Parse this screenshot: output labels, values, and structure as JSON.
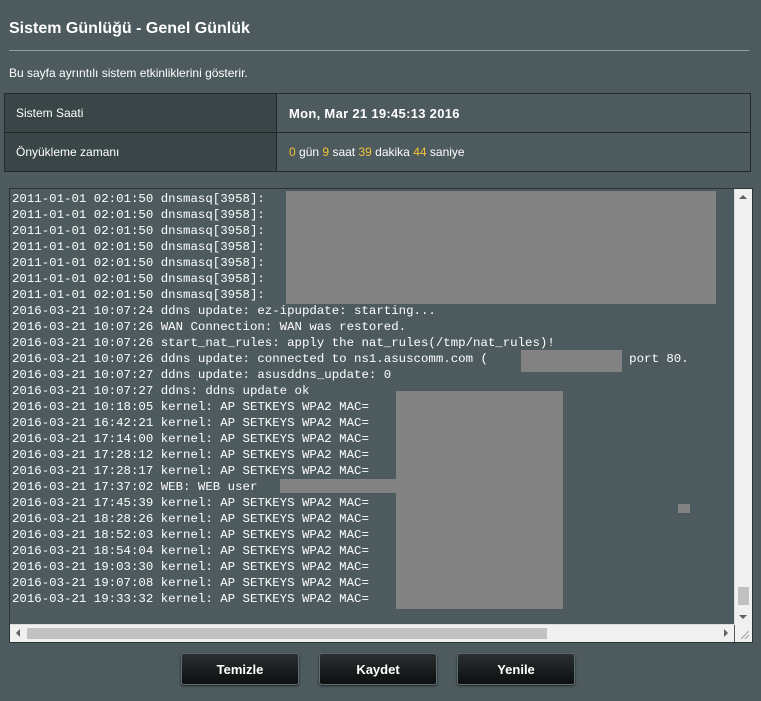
{
  "page": {
    "title": "Sistem Günlüğü - Genel Günlük",
    "description": "Bu sayfa ayrıntılı sistem etkinliklerini gösterir."
  },
  "info": {
    "system_time_label": "Sistem Saati",
    "system_time_value": "Mon, Mar 21 19:45:13 2016",
    "uptime_label": "Önyükleme zamanı",
    "uptime": {
      "days": "0",
      "days_unit": "gün",
      "hours": "9",
      "hours_unit": "saat",
      "minutes": "39",
      "minutes_unit": "dakika",
      "seconds": "44",
      "seconds_unit": "saniye"
    }
  },
  "log": {
    "lines": [
      "2011-01-01 02:01:50 dnsmasq[3958]:",
      "2011-01-01 02:01:50 dnsmasq[3958]:",
      "2011-01-01 02:01:50 dnsmasq[3958]:",
      "2011-01-01 02:01:50 dnsmasq[3958]:",
      "2011-01-01 02:01:50 dnsmasq[3958]:",
      "2011-01-01 02:01:50 dnsmasq[3958]:",
      "2011-01-01 02:01:50 dnsmasq[3958]:",
      "2016-03-21 10:07:24 ddns update: ez-ipupdate: starting...",
      "2016-03-21 10:07:26 WAN Connection: WAN was restored.",
      "2016-03-21 10:07:26 start_nat_rules: apply the nat_rules(/tmp/nat_rules)!",
      "2016-03-21 10:07:26 ddns update: connected to ns1.asuscomm.com (              ) on port 80.",
      "2016-03-21 10:07:27 ddns update: asusddns_update: 0",
      "2016-03-21 10:07:27 ddns: ddns update ok",
      "2016-03-21 10:18:05 kernel: AP SETKEYS WPA2 MAC=",
      "2016-03-21 16:42:21 kernel: AP SETKEYS WPA2 MAC=",
      "2016-03-21 17:14:00 kernel: AP SETKEYS WPA2 MAC=",
      "2016-03-21 17:28:12 kernel: AP SETKEYS WPA2 MAC=",
      "2016-03-21 17:28:17 kernel: AP SETKEYS WPA2 MAC=",
      "2016-03-21 17:37:02 WEB: WEB user",
      "2016-03-21 17:45:39 kernel: AP SETKEYS WPA2 MAC=",
      "2016-03-21 18:28:26 kernel: AP SETKEYS WPA2 MAC=",
      "2016-03-21 18:52:03 kernel: AP SETKEYS WPA2 MAC=",
      "2016-03-21 18:54:04 kernel: AP SETKEYS WPA2 MAC=",
      "2016-03-21 19:03:30 kernel: AP SETKEYS WPA2 MAC=",
      "2016-03-21 19:07:08 kernel: AP SETKEYS WPA2 MAC=",
      "2016-03-21 19:33:32 kernel: AP SETKEYS WPA2 MAC="
    ]
  },
  "buttons": {
    "clear": "Temizle",
    "save": "Kaydet",
    "refresh": "Yenile"
  },
  "colors": {
    "background": "#4d5a5e",
    "highlight_number": "#f1c232",
    "redaction": "#828282"
  }
}
